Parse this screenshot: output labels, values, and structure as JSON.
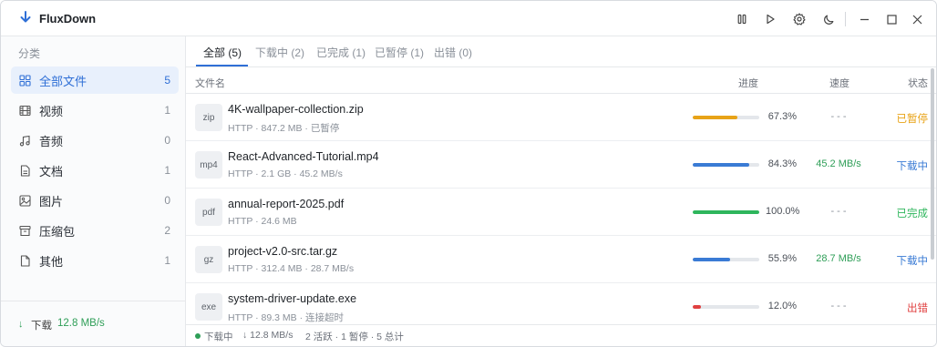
{
  "app": {
    "title": "FluxDown",
    "accent": "#2f6fd6"
  },
  "titlebar": {
    "icons": [
      "pause-all-icon",
      "play-all-icon",
      "settings-gear-icon",
      "moon-theme-icon",
      "minimize-icon",
      "maximize-icon",
      "close-icon"
    ]
  },
  "sidebar": {
    "heading": "分类",
    "items": [
      {
        "label": "全部文件",
        "count": "5",
        "icon": "grid-icon",
        "active": true
      },
      {
        "label": "视频",
        "count": "1",
        "icon": "film-icon"
      },
      {
        "label": "音频",
        "count": "0",
        "icon": "music-note-icon"
      },
      {
        "label": "文档",
        "count": "1",
        "icon": "document-icon"
      },
      {
        "label": "图片",
        "count": "0",
        "icon": "image-icon"
      },
      {
        "label": "压缩包",
        "count": "2",
        "icon": "archive-box-icon"
      },
      {
        "label": "其他",
        "count": "1",
        "icon": "file-icon"
      }
    ],
    "footer": {
      "arrow": "↓",
      "label": "下载",
      "speed": "12.8 MB/s"
    }
  },
  "tabs": [
    {
      "label": "全部 (5)",
      "active": true
    },
    {
      "label": "下载中 (2)"
    },
    {
      "label": "已完成 (1)"
    },
    {
      "label": "已暂停 (1)"
    },
    {
      "label": "出错 (0)"
    }
  ],
  "columns": {
    "name": "文件名",
    "progress": "进度",
    "speed": "速度",
    "status": "状态"
  },
  "downloads": [
    {
      "type": "zip",
      "name": "4K-wallpaper-collection.zip",
      "meta": "HTTP · 847.2 MB · 已暂停",
      "progress": 67.3,
      "pct": "67.3%",
      "speed": "- - -",
      "status": "已暂停",
      "color": "#e8a317"
    },
    {
      "type": "mp4",
      "name": "React-Advanced-Tutorial.mp4",
      "meta": "HTTP · 2.1 GB · 45.2 MB/s",
      "progress": 84.3,
      "pct": "84.3%",
      "speed": "45.2 MB/s",
      "status": "下载中",
      "color": "#3a7bd5"
    },
    {
      "type": "pdf",
      "name": "annual-report-2025.pdf",
      "meta": "HTTP · 24.6 MB",
      "progress": 100.0,
      "pct": "100.0%",
      "speed": "- - -",
      "status": "已完成",
      "color": "#2eb65c"
    },
    {
      "type": "gz",
      "name": "project-v2.0-src.tar.gz",
      "meta": "HTTP · 312.4 MB · 28.7 MB/s",
      "progress": 55.9,
      "pct": "55.9%",
      "speed": "28.7 MB/s",
      "status": "下载中",
      "color": "#3a7bd5"
    },
    {
      "type": "exe",
      "name": "system-driver-update.exe",
      "meta": "HTTP · 89.3 MB · 连接超时",
      "progress": 12.0,
      "pct": "12.0%",
      "speed": "- - -",
      "status": "出错",
      "color": "#e04040"
    }
  ],
  "statusbar": {
    "state": "下载中",
    "speed": "↓ 12.8 MB/s",
    "summary": "2 活跃 · 1 暂停 · 5 总计"
  },
  "colors": {
    "speed_active": "#2e9e57",
    "speed_idle": "#8a9099"
  }
}
